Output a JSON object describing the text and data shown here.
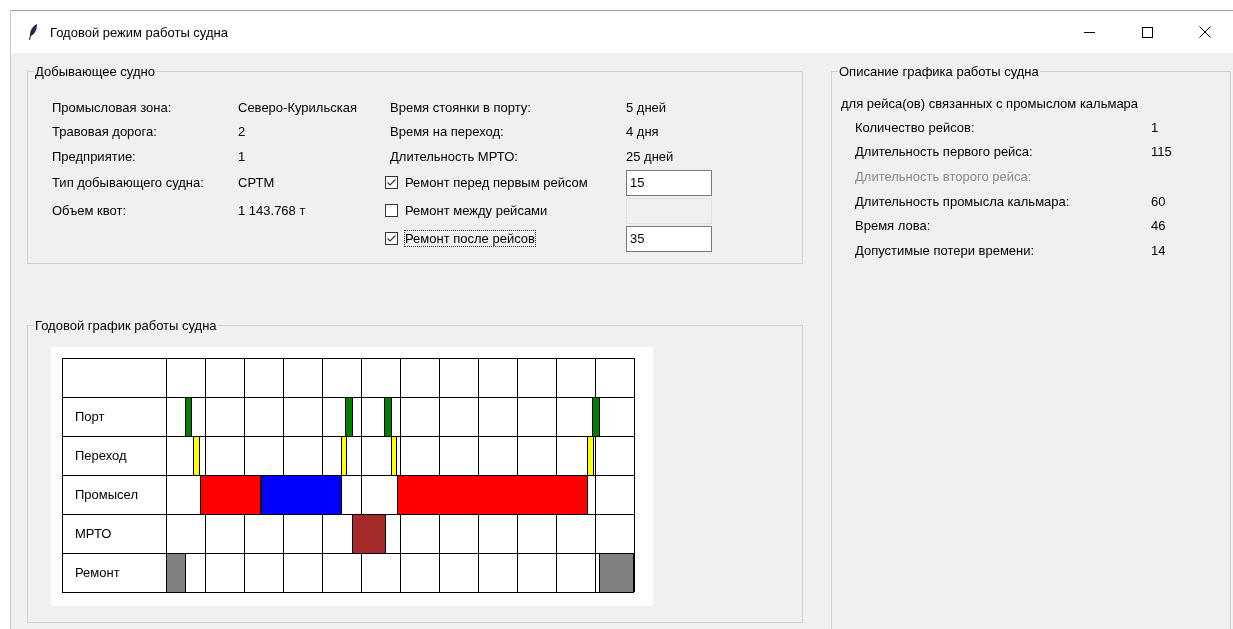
{
  "window": {
    "title": "Годовой режим работы судна"
  },
  "vessel": {
    "title": "Добывающее судно",
    "fields": [
      {
        "label": "Промысловая зона:",
        "value": "Северо-Курильская"
      },
      {
        "label": "Травовая дорога:",
        "value": "2"
      },
      {
        "label": "Предприятие:",
        "value": "1"
      },
      {
        "label": "Тип добывающего судна:",
        "value": "СРТМ"
      },
      {
        "label": "Объем квот:",
        "value": "1 143.768 т"
      }
    ],
    "params": [
      {
        "label": "Время стоянки в порту:",
        "value": "5 дней"
      },
      {
        "label": "Время на переход:",
        "value": "4 дня"
      },
      {
        "label": "Длительность МРТО:",
        "value": "25 дней"
      }
    ],
    "repairs": [
      {
        "label": "Ремонт перед первым рейсом",
        "checked": true,
        "focused": false,
        "value": "15",
        "disabled": false
      },
      {
        "label": "Ремонт между рейсами",
        "checked": false,
        "focused": false,
        "disabled": true
      },
      {
        "label": "Ремонт после рейсов",
        "checked": true,
        "focused": true,
        "value": "35",
        "disabled": false
      }
    ]
  },
  "description": {
    "title": "Описание графика работы судна",
    "subtitle": "для рейса(ов) связанных с промыслом кальмара",
    "rows": [
      {
        "label": "Количество рейсов:",
        "value": "1",
        "disabled": false
      },
      {
        "label": "Длительность первого рейса:",
        "value": "115",
        "disabled": false
      },
      {
        "label": "Длительность второго рейса:",
        "disabled": true
      },
      {
        "label": "Длительность промысла кальмара:",
        "value": "60",
        "disabled": false
      },
      {
        "label": "Время лова:",
        "value": "46",
        "disabled": false
      },
      {
        "label": "Допустимые потери времени:",
        "value": "14",
        "disabled": false
      }
    ]
  },
  "schedule": {
    "title": "Годовой график работы судна",
    "rows": [
      "Порт",
      "Переход",
      "Промысел",
      "МРТО",
      "Ремонт"
    ]
  }
}
